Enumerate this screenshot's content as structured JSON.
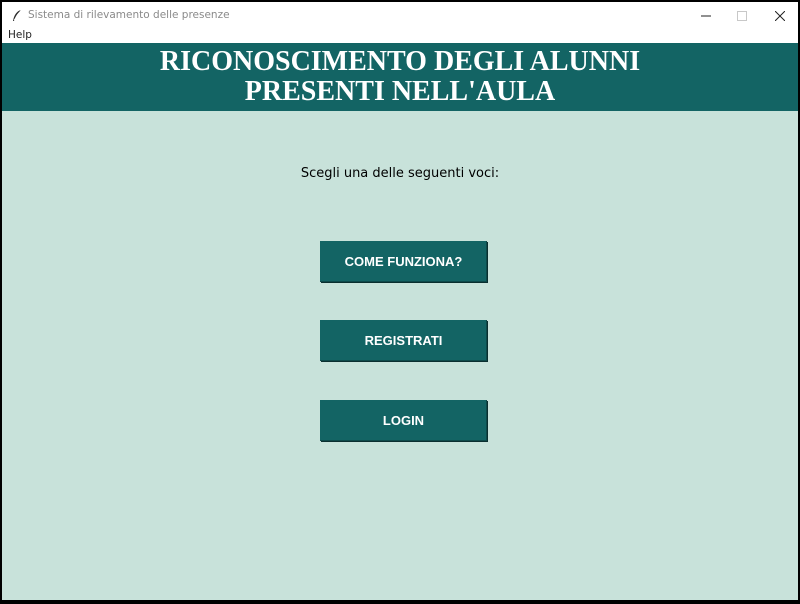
{
  "window": {
    "title": "Sistema di rilevamento delle presenze",
    "controls": {
      "minimize": "minimize-icon",
      "maximize": "maximize-icon",
      "close": "close-icon"
    }
  },
  "menubar": {
    "items": [
      {
        "label": "Help"
      }
    ]
  },
  "header": {
    "line1": "RICONOSCIMENTO DEGLI ALUNNI",
    "line2": "PRESENTI NELL'AULA"
  },
  "main": {
    "prompt": "Scegli una delle seguenti voci:",
    "buttons": [
      {
        "label": "COME FUNZIONA?"
      },
      {
        "label": "REGISTRATI"
      },
      {
        "label": "LOGIN"
      }
    ]
  },
  "colors": {
    "header_bg": "#136464",
    "button_bg": "#136464",
    "content_bg": "#c8e2da",
    "button_text": "#ffffff"
  }
}
